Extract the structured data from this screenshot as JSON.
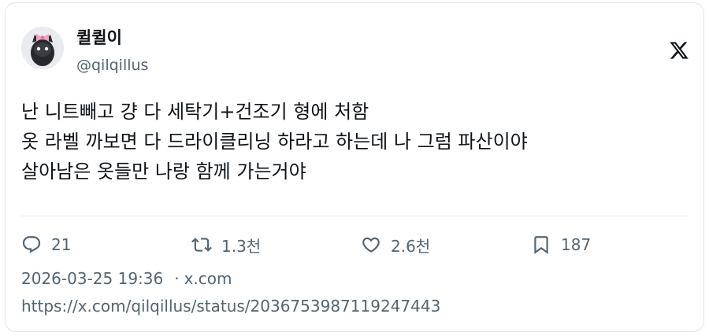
{
  "author": {
    "display_name": "퀼퀼이",
    "handle": "@qilqillus",
    "avatar_icon": "black-cat-with-pink-bow"
  },
  "platform_icon": "x-logo",
  "tweet": {
    "lines": [
      "난 니트빼고 걍 다 세탁기+건조기 형에 처함",
      "옷 라벨 까보면 다 드라이클리닝 하라고 하는데 나 그럼 파산이야",
      "살아남은 옷들만 나랑 함께 가는거야"
    ]
  },
  "actions": {
    "reply": {
      "icon": "reply-icon",
      "count": "21"
    },
    "retweet": {
      "icon": "retweet-icon",
      "count": "1.3천"
    },
    "like": {
      "icon": "heart-icon",
      "count": "2.6천"
    },
    "bookmark": {
      "icon": "bookmark-icon",
      "count": "187"
    }
  },
  "meta": {
    "datetime": "2026-03-25 19:36",
    "separator": "·",
    "source": "x.com"
  },
  "url": "https://x.com/qilqillus/status/2036753987119247443",
  "colors": {
    "text_primary": "#0f1419",
    "text_secondary": "#536471",
    "border": "#dfe3e8",
    "background": "#ffffff"
  }
}
